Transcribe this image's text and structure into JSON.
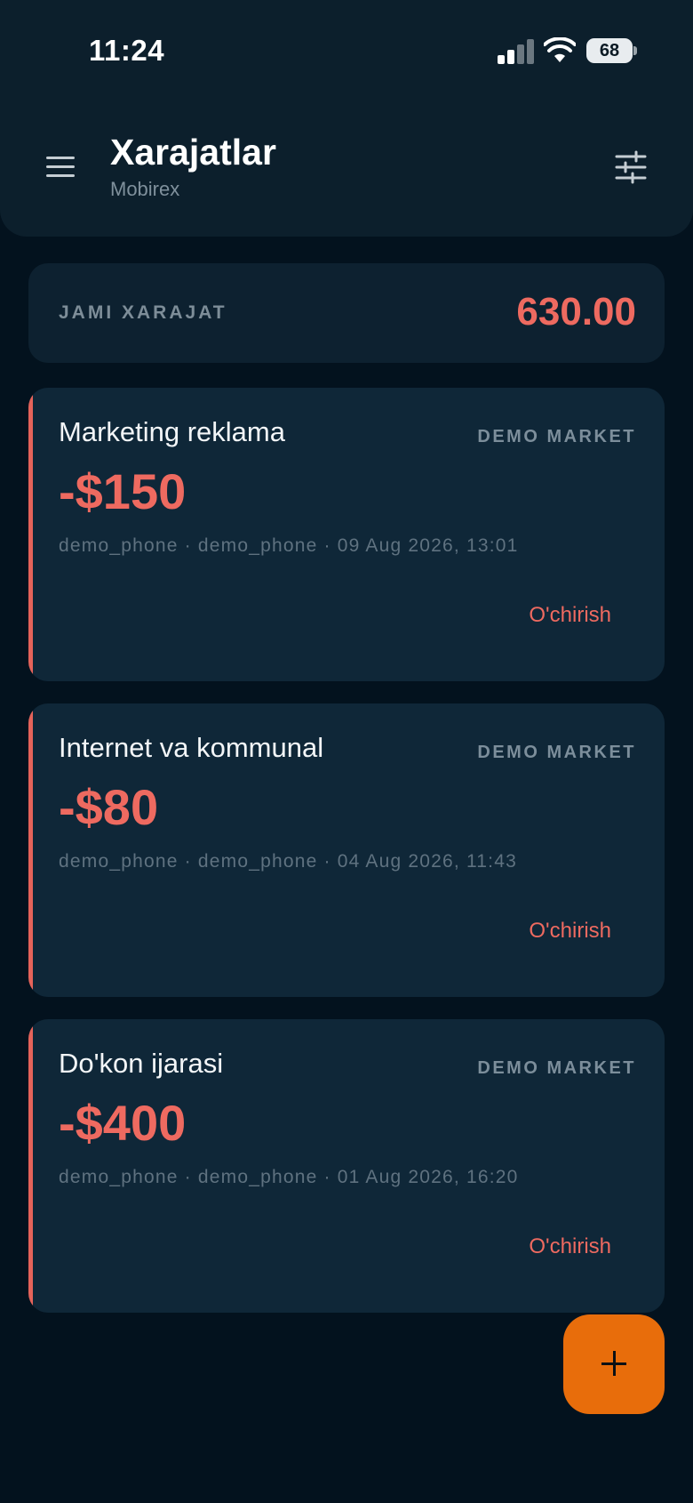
{
  "status_bar": {
    "time": "11:24",
    "battery": "68"
  },
  "header": {
    "title": "Xarajatlar",
    "subtitle": "Mobirex"
  },
  "summary": {
    "label": "JAMI XARAJAT",
    "total": "630.00"
  },
  "expenses": [
    {
      "title": "Marketing reklama",
      "store": "DEMO MARKET",
      "amount": "-$150",
      "meta": "demo_phone · demo_phone · 09 Aug 2026, 13:01",
      "delete_label": "O'chirish"
    },
    {
      "title": "Internet va kommunal",
      "store": "DEMO MARKET",
      "amount": "-$80",
      "meta": "demo_phone · demo_phone · 04 Aug 2026, 11:43",
      "delete_label": "O'chirish"
    },
    {
      "title": "Do'kon ijarasi",
      "store": "DEMO MARKET",
      "amount": "-$400",
      "meta": "demo_phone · demo_phone · 01 Aug 2026, 16:20",
      "delete_label": "O'chirish"
    }
  ],
  "icons": {
    "menu": "hamburger-menu-icon",
    "filter": "sliders-filter-icon",
    "fab": "plus-icon"
  },
  "colors": {
    "background": "#03121e",
    "card": "#0f2738",
    "accent_red": "#ee6a60",
    "fab_orange": "#e86d0b"
  }
}
